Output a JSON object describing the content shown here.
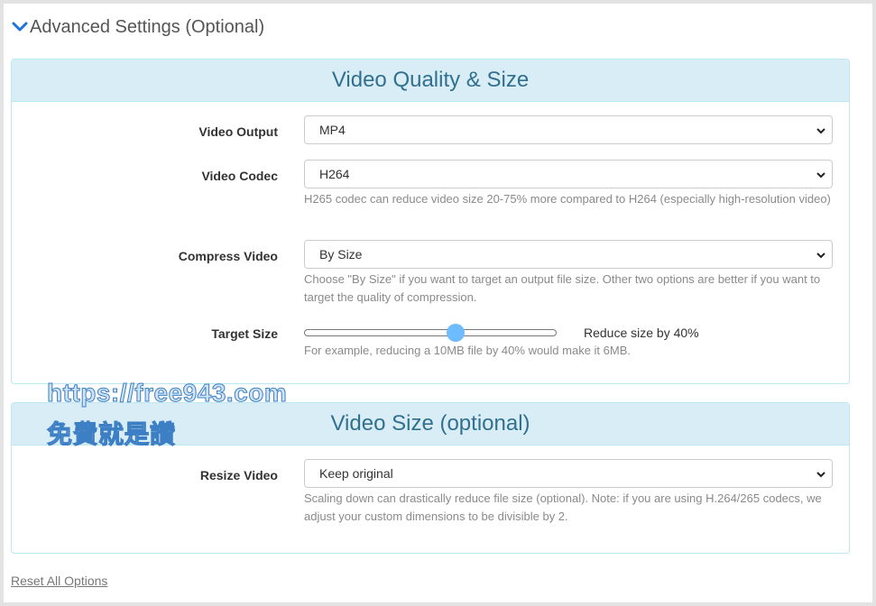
{
  "advanced": {
    "title": "Advanced Settings (Optional)",
    "icon": "chevron-down-icon",
    "accent_color": "#1e73d8"
  },
  "quality_panel": {
    "title": "Video Quality & Size",
    "video_output": {
      "label": "Video Output",
      "value": "MP4"
    },
    "video_codec": {
      "label": "Video Codec",
      "value": "H264",
      "help": "H265 codec can reduce video size 20-75% more compared to H264 (especially high-resolution video)"
    },
    "compress_video": {
      "label": "Compress Video",
      "value": "By Size",
      "help": "Choose \"By Size\" if you want to target an output file size. Other two options are better if you want to target the quality of compression."
    },
    "target_size": {
      "label": "Target Size",
      "value_text": "Reduce size by 40%",
      "slider_fraction": 0.6,
      "help": "For example, reducing a 10MB file by 40% would make it 6MB."
    }
  },
  "size_panel": {
    "title": "Video Size (optional)",
    "resize_video": {
      "label": "Resize Video",
      "value": "Keep original",
      "help": "Scaling down can drastically reduce file size (optional). Note: if you are using H.264/265 codecs, we adjust your custom dimensions to be divisible by 2."
    }
  },
  "watermark": {
    "line1": "https://free943.com",
    "line2": "免費就是讚"
  },
  "reset_label": "Reset All Options",
  "colors": {
    "panel_header_bg": "#d9edf7",
    "panel_border": "#bce8f1",
    "panel_title": "#31708f",
    "slider_thumb": "#6cbcff"
  }
}
